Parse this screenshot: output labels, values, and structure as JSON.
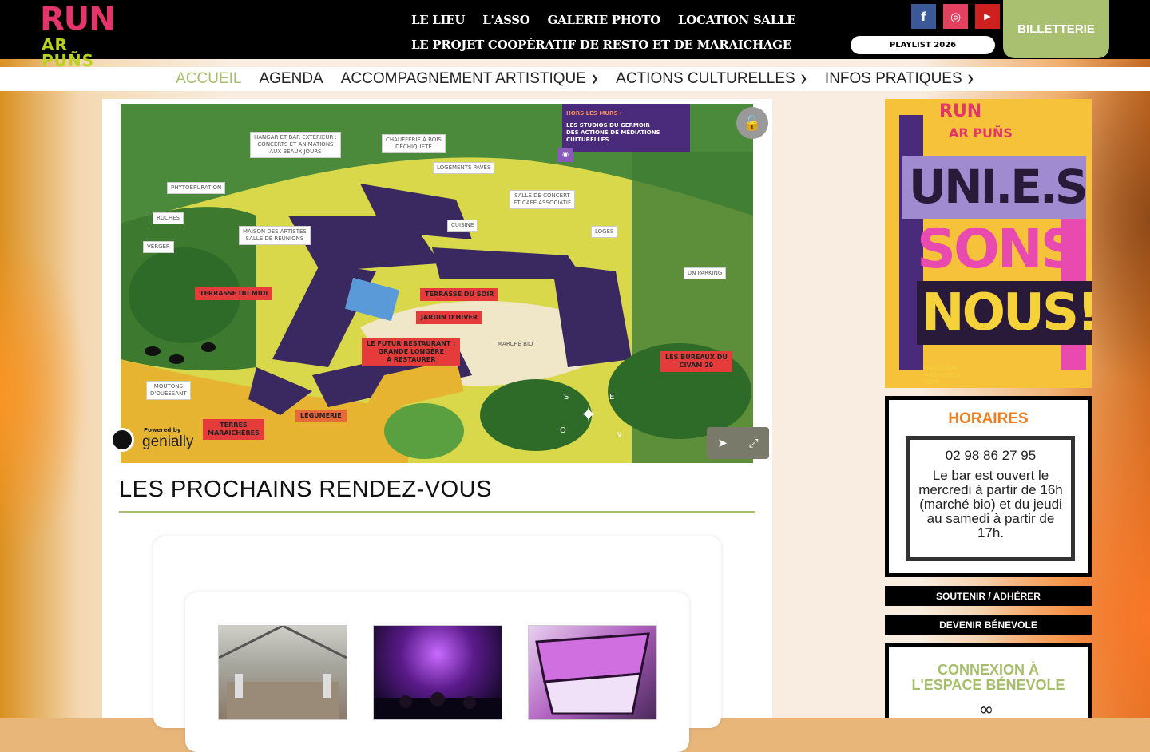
{
  "logo": {
    "line1": "RUN",
    "line2": "AR PUÑS"
  },
  "topnav": {
    "items": [
      "LE LIEU",
      "L'ASSO",
      "GALERIE PHOTO",
      "LOCATION SALLE"
    ],
    "secondary": "LE PROJET COOPÉRATIF DE RESTO ET DE MARAICHAGE"
  },
  "social": [
    {
      "icon": "facebook-icon",
      "glyph": "f",
      "color": "#3b5998"
    },
    {
      "icon": "instagram-icon",
      "glyph": "◎",
      "color": "#e4405f"
    },
    {
      "icon": "youtube-icon",
      "glyph": "▶",
      "color": "#cd201f"
    }
  ],
  "playlist": "PLAYLIST 2026",
  "billetterie": "BILLETTERIE",
  "mainnav": [
    {
      "label": "ACCUEIL",
      "active": true,
      "dropdown": false
    },
    {
      "label": "AGENDA",
      "active": false,
      "dropdown": false
    },
    {
      "label": "ACCOMPAGNEMENT ARTISTIQUE",
      "active": false,
      "dropdown": true
    },
    {
      "label": "ACTIONS CULTURELLES",
      "active": false,
      "dropdown": true
    },
    {
      "label": "INFOS PRATIQUES",
      "active": false,
      "dropdown": true
    }
  ],
  "map": {
    "hors_title": "HORS LES MURS :",
    "hors_text": "LES STUDIOS DU GERMOIR\nDES ACTIONS DE MÉDIATIONS CULTURELLES",
    "white_labels": [
      "HANGAR ET BAR EXTÉRIEUR :\nCONCERTS ET ANIMATIONS\nAUX BEAUX JOURS",
      "CHAUFFERIE À BOIS\nDÉCHIQUETÉ",
      "LOGEMENTS PAVÉS",
      "SALLE DE CONCERT\nET CAFÉ ASSOCIATIF",
      "PHYTOÉPURATION",
      "RUCHES",
      "VERGER",
      "MAISON DES ARTISTES\nSALLE DE RÉUNIONS",
      "CUISINE",
      "LOGES",
      "UN PARKING",
      "MARCHÉ BIO",
      "MOUTONS\nD'OUESSANT"
    ],
    "red_labels": [
      "TERRASSE DU MIDI",
      "TERRASSE DU SOIR",
      "JARDIN D'HIVER",
      "LE FUTUR RESTAURANT :\nGRANDE LONGÈRE\nÀ RESTAURER",
      "LES BUREAUX DU\nCIVAM 29",
      "LÉGUMERIE",
      "TERRES\nMARAICHÈRES"
    ],
    "compass": [
      "S",
      "E",
      "O",
      "N"
    ],
    "powered_by": "Powered by",
    "genially": "genially"
  },
  "section_title": "LES PROCHAINS RENDEZ-VOUS",
  "poster": {
    "logo_line1": "RUN",
    "logo_line2": "AR PUÑS",
    "line1": "UNI.E.S",
    "line2": "SONS",
    "line3": "NOUS!",
    "dates": "septembre\n→décembre\n2026"
  },
  "horaires": {
    "title": "HORAIRES",
    "phone": "02 98 86 27 95",
    "text": "Le bar est ouvert le mercredi à partir de 16h (marché bio) et du jeudi au samedi à partir de 17h."
  },
  "buttons": {
    "soutenir": "SOUTENIR / ADHÉRER",
    "benevole": "DEVENIR BÉNEVOLE"
  },
  "connexion": {
    "title": "CONNEXION À\nL'ESPACE BÉNEVOLE"
  }
}
